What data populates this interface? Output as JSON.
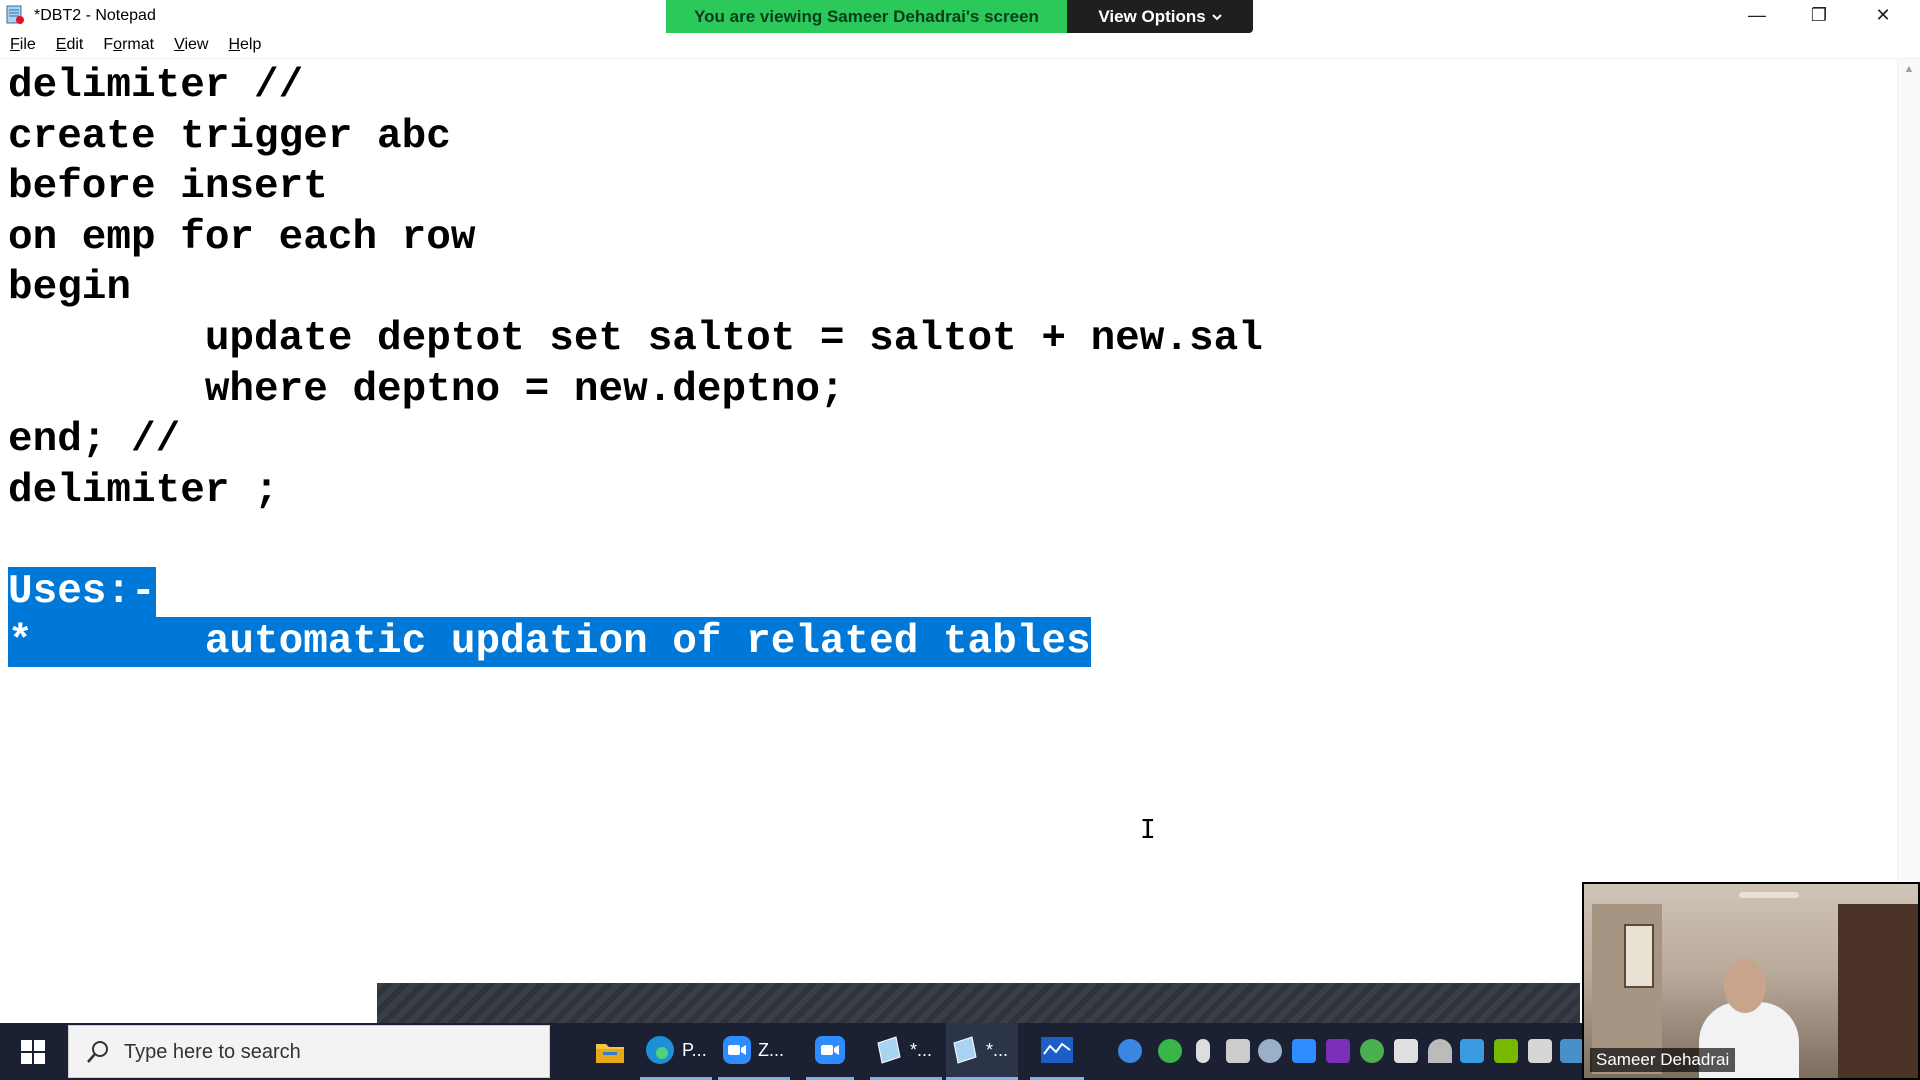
{
  "window": {
    "title": "*DBT2 - Notepad",
    "controls": {
      "minimize": "—",
      "restore": "❐",
      "close": "✕"
    }
  },
  "share_banner": {
    "text": "You are viewing Sameer Dehadrai's screen",
    "view_options": "View Options",
    "colors": {
      "banner": "#2bc85a",
      "options_bg": "#1f1f1f"
    }
  },
  "menu": [
    {
      "label": "File",
      "mnemonic": "F",
      "rest": "ile"
    },
    {
      "label": "Edit",
      "mnemonic": "E",
      "rest": "dit"
    },
    {
      "label": "Format",
      "mnemonic": "o",
      "pre": "F",
      "rest": "rmat"
    },
    {
      "label": "View",
      "mnemonic": "V",
      "rest": "iew"
    },
    {
      "label": "Help",
      "mnemonic": "H",
      "rest": "elp"
    }
  ],
  "editor": {
    "lines": [
      "delimiter //",
      "create trigger abc",
      "before insert",
      "on emp for each row",
      "begin",
      "        update deptot set saltot = saltot + new.sal",
      "        where deptno = new.deptno;",
      "end; //",
      "delimiter ;",
      "",
      "Uses:-",
      "*       automatic updation of related tables"
    ],
    "selection_color": "#0078d7"
  },
  "taskbar": {
    "search_placeholder": "Type here to search",
    "apps": [
      {
        "name": "file-explorer",
        "label": ""
      },
      {
        "name": "edge",
        "label": "P..."
      },
      {
        "name": "zoom",
        "label": "Z..."
      },
      {
        "name": "zoom-meeting",
        "label": ""
      },
      {
        "name": "notepad-1",
        "label": "*..."
      },
      {
        "name": "notepad-2",
        "label": "*..."
      },
      {
        "name": "whiteboard",
        "label": ""
      }
    ]
  },
  "video": {
    "participant_name": "Sameer Dehadrai"
  }
}
